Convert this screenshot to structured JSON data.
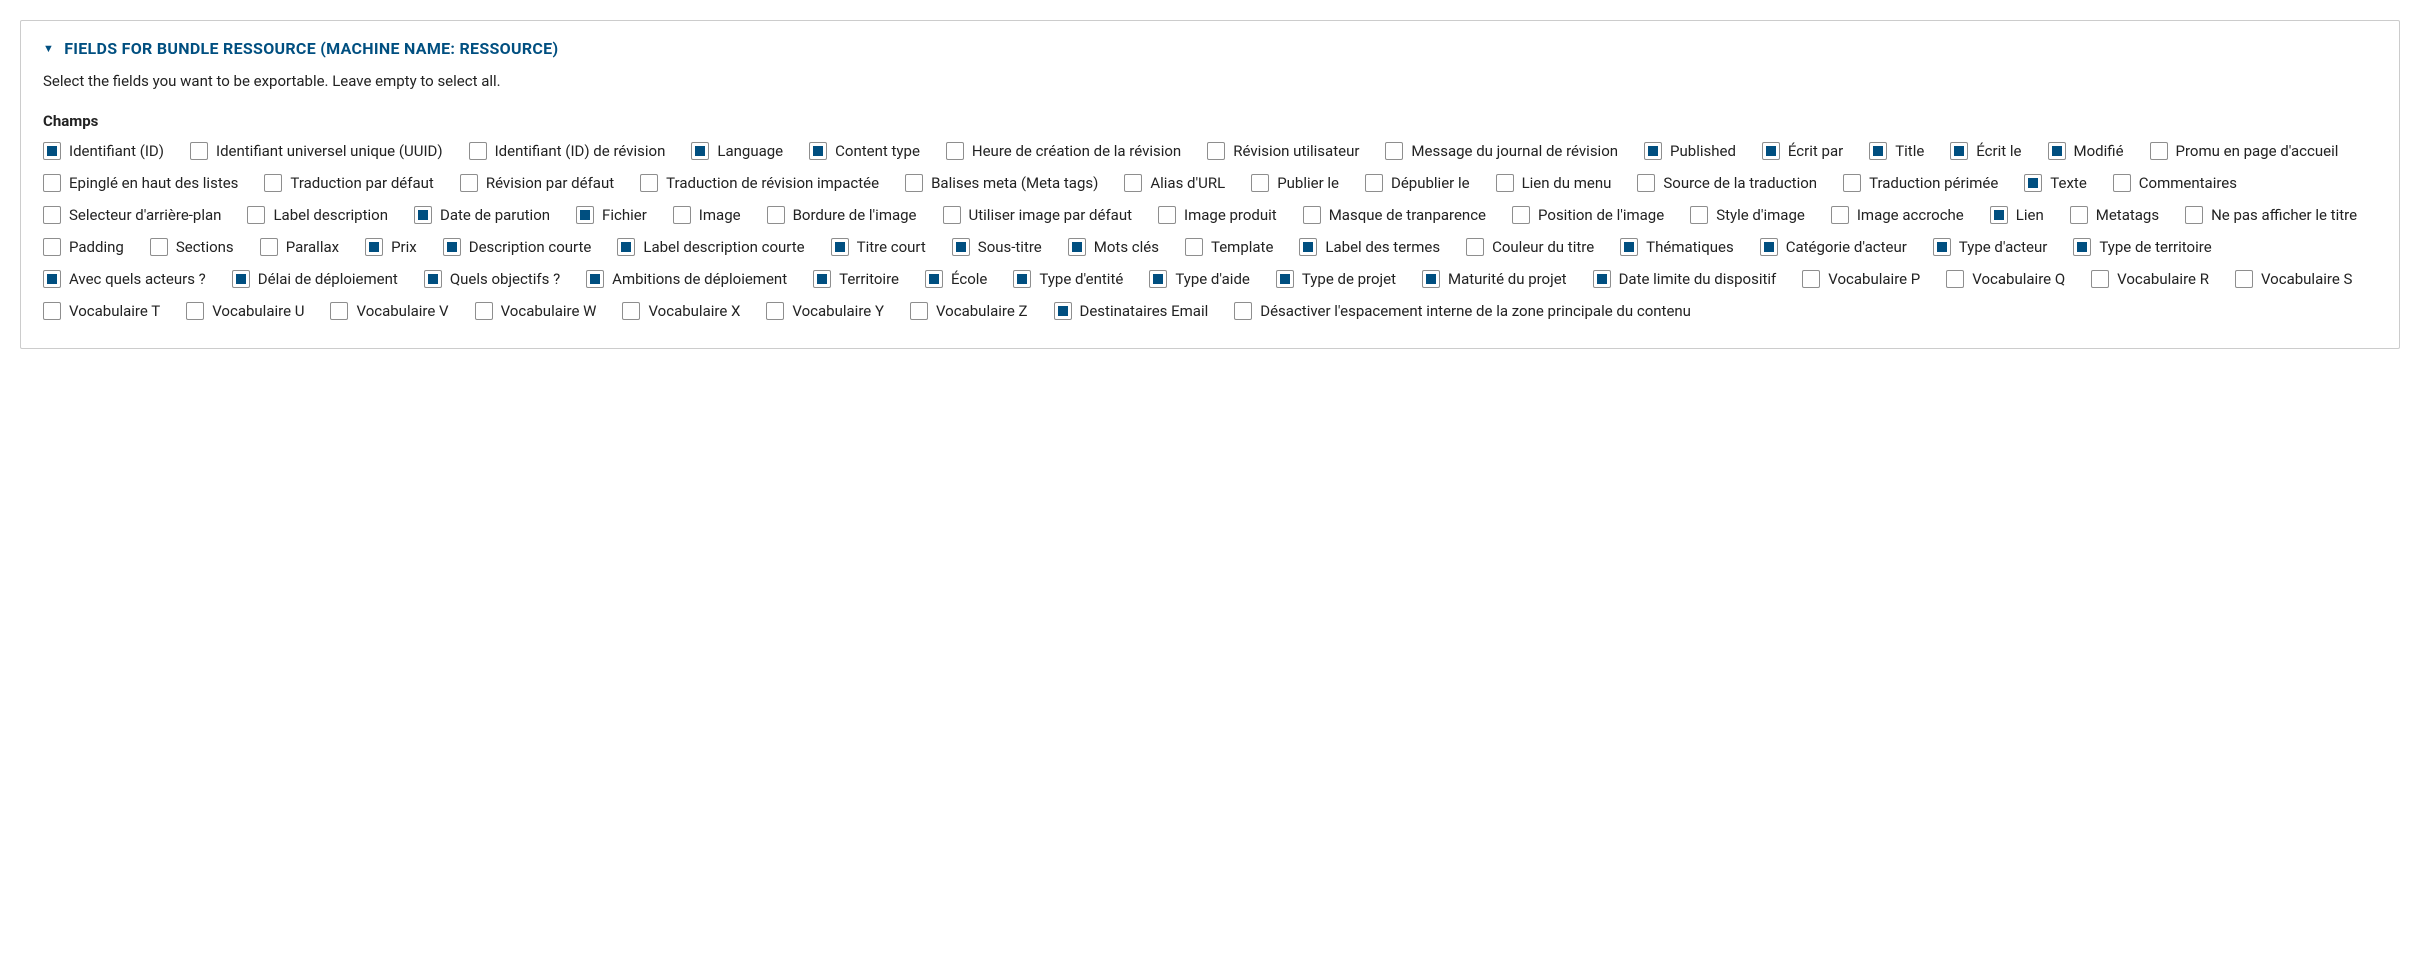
{
  "fieldset": {
    "title": "FIELDS FOR BUNDLE RESSOURCE (MACHINE NAME: RESSOURCE)",
    "description": "Select the fields you want to be exportable. Leave empty to select all.",
    "group_label": "Champs",
    "fields": [
      {
        "id": "identifiant-id",
        "label": "Identifiant (ID)",
        "checked": true
      },
      {
        "id": "uuid",
        "label": "Identifiant universel unique (UUID)",
        "checked": false
      },
      {
        "id": "revision-id",
        "label": "Identifiant (ID) de révision",
        "checked": false
      },
      {
        "id": "language",
        "label": "Language",
        "checked": true
      },
      {
        "id": "content-type",
        "label": "Content type",
        "checked": true
      },
      {
        "id": "revision-time",
        "label": "Heure de création de la révision",
        "checked": false
      },
      {
        "id": "revision-user",
        "label": "Révision utilisateur",
        "checked": false
      },
      {
        "id": "revision-log",
        "label": "Message du journal de révision",
        "checked": false
      },
      {
        "id": "published",
        "label": "Published",
        "checked": true
      },
      {
        "id": "ecrit-par",
        "label": "Écrit par",
        "checked": true
      },
      {
        "id": "title",
        "label": "Title",
        "checked": true
      },
      {
        "id": "ecrit-le",
        "label": "Écrit le",
        "checked": true
      },
      {
        "id": "modifie",
        "label": "Modifié",
        "checked": true
      },
      {
        "id": "promu",
        "label": "Promu en page d'accueil",
        "checked": false
      },
      {
        "id": "sticky",
        "label": "Epinglé en haut des listes",
        "checked": false
      },
      {
        "id": "default-trans",
        "label": "Traduction par défaut",
        "checked": false
      },
      {
        "id": "default-rev",
        "label": "Révision par défaut",
        "checked": false
      },
      {
        "id": "rev-trans-affected",
        "label": "Traduction de révision impactée",
        "checked": false
      },
      {
        "id": "meta-tags",
        "label": "Balises meta (Meta tags)",
        "checked": false
      },
      {
        "id": "url-alias",
        "label": "Alias d'URL",
        "checked": false
      },
      {
        "id": "publish-on",
        "label": "Publier le",
        "checked": false
      },
      {
        "id": "unpublish-on",
        "label": "Dépublier le",
        "checked": false
      },
      {
        "id": "menu-link",
        "label": "Lien du menu",
        "checked": false
      },
      {
        "id": "trans-source",
        "label": "Source de la traduction",
        "checked": false
      },
      {
        "id": "trans-outdated",
        "label": "Traduction périmée",
        "checked": false
      },
      {
        "id": "texte",
        "label": "Texte",
        "checked": true
      },
      {
        "id": "commentaires",
        "label": "Commentaires",
        "checked": false
      },
      {
        "id": "bg-selector",
        "label": "Selecteur d'arrière-plan",
        "checked": false
      },
      {
        "id": "label-desc",
        "label": "Label description",
        "checked": false
      },
      {
        "id": "date-parution",
        "label": "Date de parution",
        "checked": true
      },
      {
        "id": "fichier",
        "label": "Fichier",
        "checked": true
      },
      {
        "id": "image",
        "label": "Image",
        "checked": false
      },
      {
        "id": "image-border",
        "label": "Bordure de l'image",
        "checked": false
      },
      {
        "id": "use-default-image",
        "label": "Utiliser image par défaut",
        "checked": false
      },
      {
        "id": "image-produit",
        "label": "Image produit",
        "checked": false
      },
      {
        "id": "transparency-mask",
        "label": "Masque de tranparence",
        "checked": false
      },
      {
        "id": "image-position",
        "label": "Position de l'image",
        "checked": false
      },
      {
        "id": "image-style",
        "label": "Style d'image",
        "checked": false
      },
      {
        "id": "image-accroche",
        "label": "Image accroche",
        "checked": false
      },
      {
        "id": "lien",
        "label": "Lien",
        "checked": true
      },
      {
        "id": "metatags2",
        "label": "Metatags",
        "checked": false
      },
      {
        "id": "hide-title",
        "label": "Ne pas afficher le titre",
        "checked": false
      },
      {
        "id": "padding",
        "label": "Padding",
        "checked": false
      },
      {
        "id": "sections",
        "label": "Sections",
        "checked": false
      },
      {
        "id": "parallax",
        "label": "Parallax",
        "checked": false
      },
      {
        "id": "prix",
        "label": "Prix",
        "checked": true
      },
      {
        "id": "desc-courte",
        "label": "Description courte",
        "checked": true
      },
      {
        "id": "label-desc-courte",
        "label": "Label description courte",
        "checked": true
      },
      {
        "id": "titre-court",
        "label": "Titre court",
        "checked": true
      },
      {
        "id": "sous-titre",
        "label": "Sous-titre",
        "checked": true
      },
      {
        "id": "mots-cles",
        "label": "Mots clés",
        "checked": true
      },
      {
        "id": "template",
        "label": "Template",
        "checked": false
      },
      {
        "id": "label-termes",
        "label": "Label des termes",
        "checked": true
      },
      {
        "id": "couleur-titre",
        "label": "Couleur du titre",
        "checked": false
      },
      {
        "id": "thematiques",
        "label": "Thématiques",
        "checked": true
      },
      {
        "id": "categorie-acteur",
        "label": "Catégorie d'acteur",
        "checked": true
      },
      {
        "id": "type-acteur",
        "label": "Type d'acteur",
        "checked": true
      },
      {
        "id": "type-territoire",
        "label": "Type de territoire",
        "checked": true
      },
      {
        "id": "avec-quels-acteurs",
        "label": "Avec quels acteurs ?",
        "checked": true
      },
      {
        "id": "delai-deploiement",
        "label": "Délai de déploiement",
        "checked": true
      },
      {
        "id": "quels-objectifs",
        "label": "Quels objectifs ?",
        "checked": true
      },
      {
        "id": "ambitions-deploiement",
        "label": "Ambitions de déploiement",
        "checked": true
      },
      {
        "id": "territoire",
        "label": "Territoire",
        "checked": true
      },
      {
        "id": "ecole",
        "label": "École",
        "checked": true
      },
      {
        "id": "type-entite",
        "label": "Type d'entité",
        "checked": true
      },
      {
        "id": "type-aide",
        "label": "Type d'aide",
        "checked": true
      },
      {
        "id": "type-projet",
        "label": "Type de projet",
        "checked": true
      },
      {
        "id": "maturite-projet",
        "label": "Maturité du projet",
        "checked": true
      },
      {
        "id": "date-limite",
        "label": "Date limite du dispositif",
        "checked": true
      },
      {
        "id": "vocab-p",
        "label": "Vocabulaire P",
        "checked": false
      },
      {
        "id": "vocab-q",
        "label": "Vocabulaire Q",
        "checked": false
      },
      {
        "id": "vocab-r",
        "label": "Vocabulaire R",
        "checked": false
      },
      {
        "id": "vocab-s",
        "label": "Vocabulaire S",
        "checked": false
      },
      {
        "id": "vocab-t",
        "label": "Vocabulaire T",
        "checked": false
      },
      {
        "id": "vocab-u",
        "label": "Vocabulaire U",
        "checked": false
      },
      {
        "id": "vocab-v",
        "label": "Vocabulaire V",
        "checked": false
      },
      {
        "id": "vocab-w",
        "label": "Vocabulaire W",
        "checked": false
      },
      {
        "id": "vocab-x",
        "label": "Vocabulaire X",
        "checked": false
      },
      {
        "id": "vocab-y",
        "label": "Vocabulaire Y",
        "checked": false
      },
      {
        "id": "vocab-z",
        "label": "Vocabulaire Z",
        "checked": false
      },
      {
        "id": "destinataires-email",
        "label": "Destinataires Email",
        "checked": true
      },
      {
        "id": "disable-main-padding",
        "label": "Désactiver l'espacement interne de la zone principale du contenu",
        "checked": false
      }
    ]
  }
}
